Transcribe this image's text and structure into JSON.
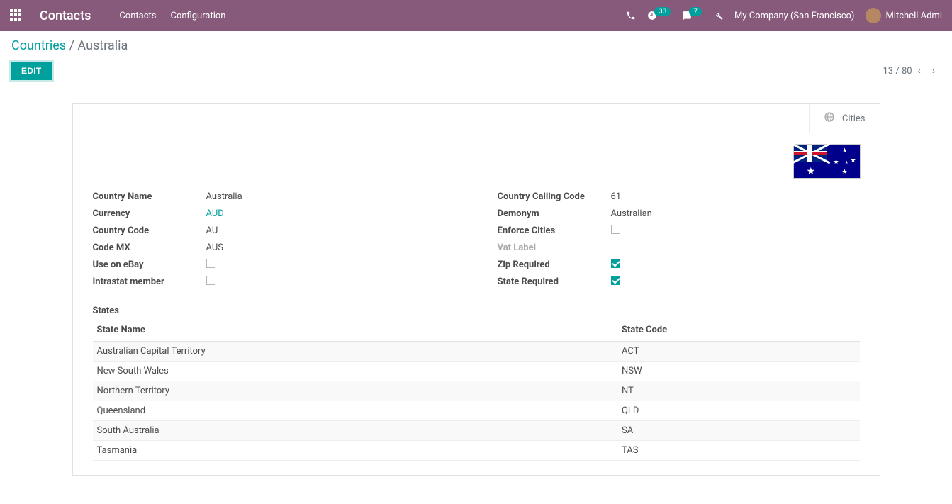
{
  "nav": {
    "brand": "Contacts",
    "menu": [
      "Contacts",
      "Configuration"
    ],
    "badge_clock": "33",
    "badge_chat": "7",
    "company": "My Company (San Francisco)",
    "user": "Mitchell Admi"
  },
  "breadcrumb": {
    "parent": "Countries",
    "current": "Australia"
  },
  "buttons": {
    "edit": "EDIT"
  },
  "pager": {
    "pos": "13",
    "total": "80"
  },
  "statbox": {
    "cities": "Cities"
  },
  "fields": {
    "left": {
      "country_name_label": "Country Name",
      "country_name": "Australia",
      "currency_label": "Currency",
      "currency": "AUD",
      "country_code_label": "Country Code",
      "country_code": "AU",
      "code_mx_label": "Code MX",
      "code_mx": "AUS",
      "use_ebay_label": "Use on eBay",
      "use_ebay": false,
      "intrastat_label": "Intrastat member",
      "intrastat": false
    },
    "right": {
      "calling_code_label": "Country Calling Code",
      "calling_code": "61",
      "demonym_label": "Demonym",
      "demonym": "Australian",
      "enforce_cities_label": "Enforce Cities",
      "enforce_cities": false,
      "vat_label_label": "Vat Label",
      "vat_label": "",
      "zip_required_label": "Zip Required",
      "zip_required": true,
      "state_required_label": "State Required",
      "state_required": true
    }
  },
  "states_section": "States",
  "states_headers": {
    "name": "State Name",
    "code": "State Code"
  },
  "states": [
    {
      "name": "Australian Capital Territory",
      "code": "ACT"
    },
    {
      "name": "New South Wales",
      "code": "NSW"
    },
    {
      "name": "Northern Territory",
      "code": "NT"
    },
    {
      "name": "Queensland",
      "code": "QLD"
    },
    {
      "name": "South Australia",
      "code": "SA"
    },
    {
      "name": "Tasmania",
      "code": "TAS"
    }
  ]
}
